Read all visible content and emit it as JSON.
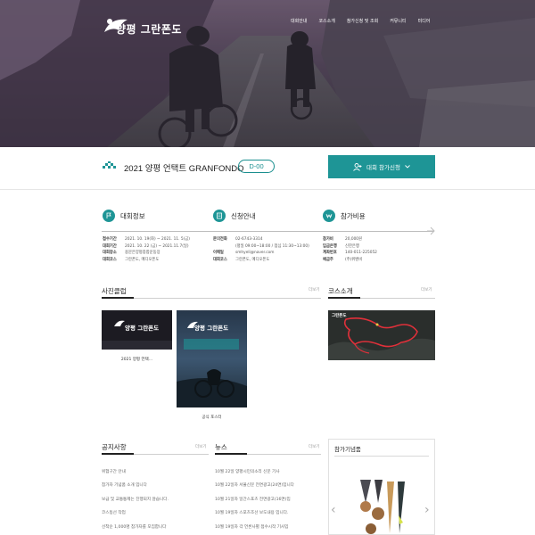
{
  "brand": {
    "logo_text": "양평 그란폰도"
  },
  "nav": {
    "items": [
      "대회안내",
      "코스소개",
      "참가신청 및 조회",
      "커뮤니티",
      "미디어"
    ]
  },
  "event": {
    "title": "2021 양평 언택트 GRANFONDO",
    "dday": "D-00",
    "apply_label": "대회 참가신청"
  },
  "info": {
    "competition": {
      "title": "대회정보",
      "rows": [
        {
          "k": "접수기간",
          "v": "2021. 10. 19(화) ~ 2021. 11. 5(금)"
        },
        {
          "k": "대회기간",
          "v": "2021. 10. 22 (금) ~ 2021.11.7(일)"
        },
        {
          "k": "대회장소",
          "v": "용문은양평종합운동장"
        },
        {
          "k": "대회코스",
          "v": "그란폰도, 메디오폰도"
        }
      ]
    },
    "application": {
      "title": "신청안내",
      "rows": [
        {
          "k": "문의전화",
          "v": "02-6743-3314"
        },
        {
          "k": "",
          "v": "(평일 09:00~18:00 / 점심 11:30~13:00)"
        },
        {
          "k": "이메일",
          "v": "smhyeli@naver.com"
        },
        {
          "k": "대회코스",
          "v": "그란폰도, 메디오폰도"
        }
      ]
    },
    "fee": {
      "title": "참가비용",
      "rows": [
        {
          "k": "참가비",
          "v": "20,000원"
        },
        {
          "k": "입금은행",
          "v": "신한은행"
        },
        {
          "k": "계좌번호",
          "v": "140-011-225052"
        },
        {
          "k": "예금주",
          "v": "(주)위밴비"
        }
      ]
    }
  },
  "photo_club": {
    "title": "사진클럽",
    "more": "더보기",
    "items": [
      {
        "caption": "2021 양평 언택...",
        "logo": "양평 그란폰도"
      },
      {
        "caption": "공식 포스터",
        "logo": "양평 그란폰도"
      }
    ]
  },
  "course": {
    "title": "코스소개",
    "more": "더보기",
    "map_label": "그란폰도"
  },
  "notice": {
    "title": "공지사항",
    "more": "더보기",
    "items": [
      "위험구간 안내",
      "참가자 기념품 소개 입니다",
      "보급 및 교통통제는 진행되지 않습니다.",
      "코스동선 작업",
      "선착순 1,000명 참가자를 모집합니다"
    ]
  },
  "news": {
    "title": "뉴스",
    "more": "더보기",
    "items": [
      "10월 22일 양평시민의소리 신문 기사",
      "10월 22일자 서울신문 전면광고(24면)입니다",
      "10월 21일자 일간스포츠 전면광고(16면)입",
      "10월 19일자 스포츠조선 보도내용 입니다.",
      "10월 19일자 각 언론사별 접수시작 기사입"
    ]
  },
  "souvenir": {
    "title": "참가기념품"
  },
  "colors": {
    "accent": "#1e9596",
    "hero_tint": "#5b4a62"
  }
}
